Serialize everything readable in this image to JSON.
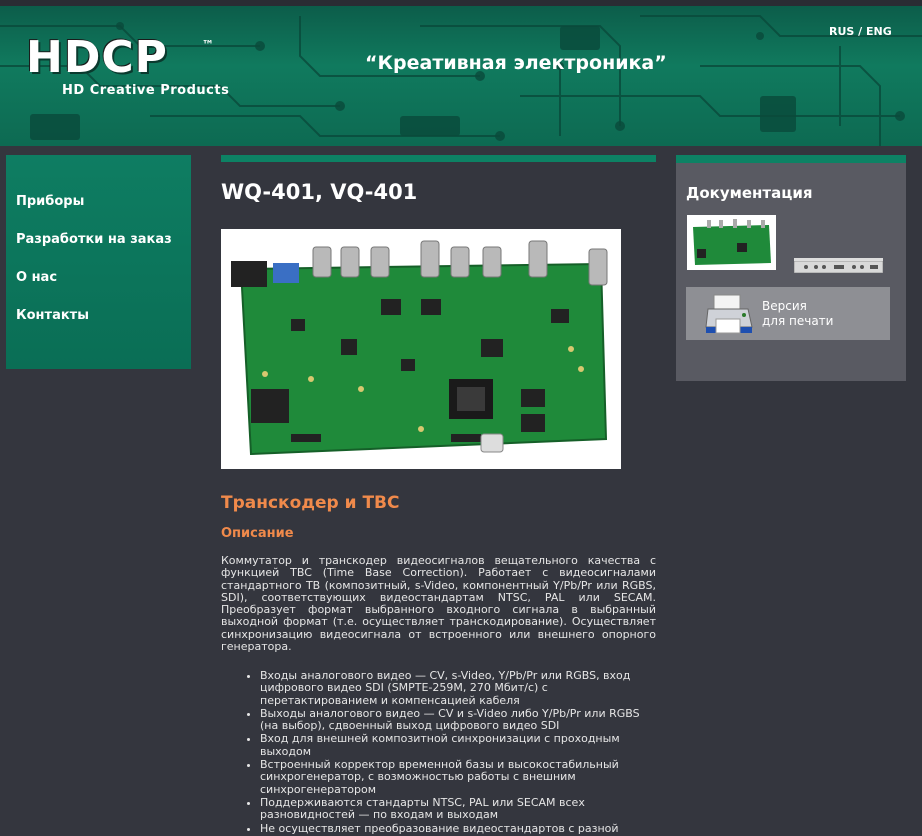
{
  "header": {
    "logo": "HDCP",
    "logo_tm": "™",
    "logo_sub": "HD Creative Products",
    "slogan": "“Креативная электроника”",
    "lang_rus": "RUS",
    "lang_sep": " / ",
    "lang_eng": "ENG"
  },
  "nav": {
    "items": [
      {
        "label": "Приборы"
      },
      {
        "label": "Разработки на заказ"
      },
      {
        "label": "О нас"
      },
      {
        "label": "Контакты"
      }
    ]
  },
  "main": {
    "title": "WQ-401, VQ-401",
    "subtitle": "Транскодер и TBC",
    "section": "Описание",
    "description": "Коммутатор и транскодер видеосигналов вещательного качества с функцией TBC (Time Base Correction). Работает с видеосигналами стандартного ТВ (композитный, s-Video, компонентный Y/Pb/Pr или RGBS, SDI), соответствующих видеостандартам NTSC, PAL или SECAM. Преобразует формат выбранного входного сигнала в выбранный выходной формат (т.е. осуществляет транскодирование). Осуществляет синхронизацию видеосигнала от встроенного или внешнего опорного генератора.",
    "features": [
      "Входы аналогового видео — CV, s-Video, Y/Pb/Pr или RGBS, вход цифрового видео SDI (SMPTE-259M, 270 Мбит/с) с перетактированием и компенсацией кабеля",
      "Выходы аналогового видео — CV и s-Video либо Y/Pb/Pr или RGBS (на выбор), сдвоенный выход цифрового видео SDI",
      "Вход для внешней композитной синхронизации с проходным выходом",
      "Встроенный корректор временной базы и высокостабильный синхрогенератор, с возможностью работы с внешним синхрогенератором",
      "Поддерживаются стандарты NTSC, PAL или SECAM всех разновидностей — по входам и выходам",
      "Не осуществляет преобразование видеостандартов с разной"
    ]
  },
  "sidebar": {
    "doc_title": "Документация",
    "print_line1": "Версия",
    "print_line2": "для печати",
    "print_icon": "printer-icon"
  },
  "colors": {
    "accent_green": "#0d8264",
    "orange": "#f08a4b",
    "background": "#34363e"
  }
}
